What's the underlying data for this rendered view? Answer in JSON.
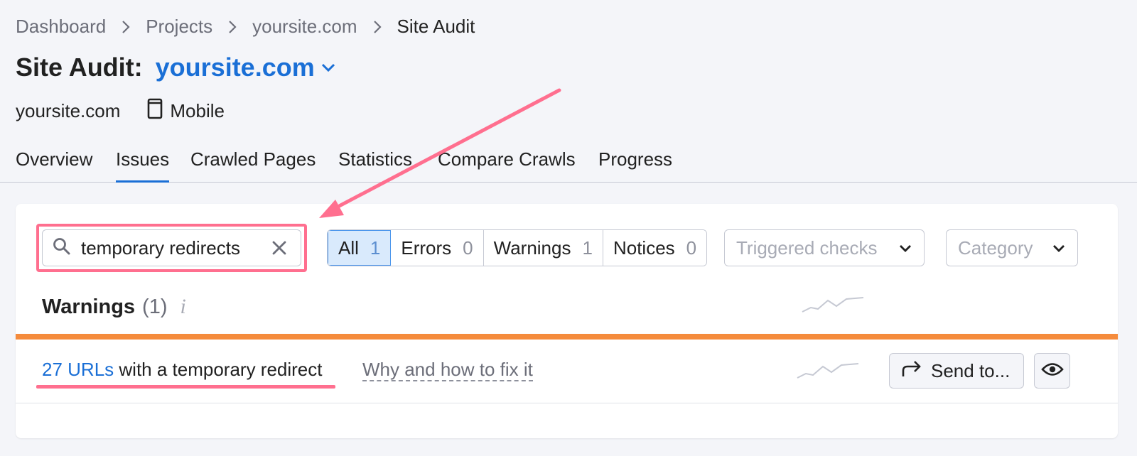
{
  "breadcrumb": {
    "items": [
      "Dashboard",
      "Projects",
      "yoursite.com",
      "Site Audit"
    ]
  },
  "header": {
    "title_prefix": "Site Audit:",
    "domain": "yoursite.com"
  },
  "meta": {
    "site": "yoursite.com",
    "device": "Mobile",
    "device_icon": "mobile-phone-icon"
  },
  "tabs": [
    "Overview",
    "Issues",
    "Crawled Pages",
    "Statistics",
    "Compare Crawls",
    "Progress"
  ],
  "active_tab": "Issues",
  "filters": {
    "search_value": "temporary redirects",
    "segments": [
      {
        "label": "All",
        "count": "1"
      },
      {
        "label": "Errors",
        "count": "0"
      },
      {
        "label": "Warnings",
        "count": "1"
      },
      {
        "label": "Notices",
        "count": "0"
      }
    ],
    "triggered_checks_placeholder": "Triggered checks",
    "category_placeholder": "Category"
  },
  "section": {
    "title": "Warnings",
    "count": "(1)",
    "info_icon": "i"
  },
  "issue": {
    "link_text": "27 URLs",
    "rest_text": "with a temporary redirect",
    "fix_link": "Why and how to fix it",
    "send_button": "Send to..."
  },
  "colors": {
    "accent": "#1a6fd6",
    "warning_bar": "#f58b3c",
    "highlight": "#ff6f8f",
    "active_segment_bg": "#d9eafc"
  }
}
